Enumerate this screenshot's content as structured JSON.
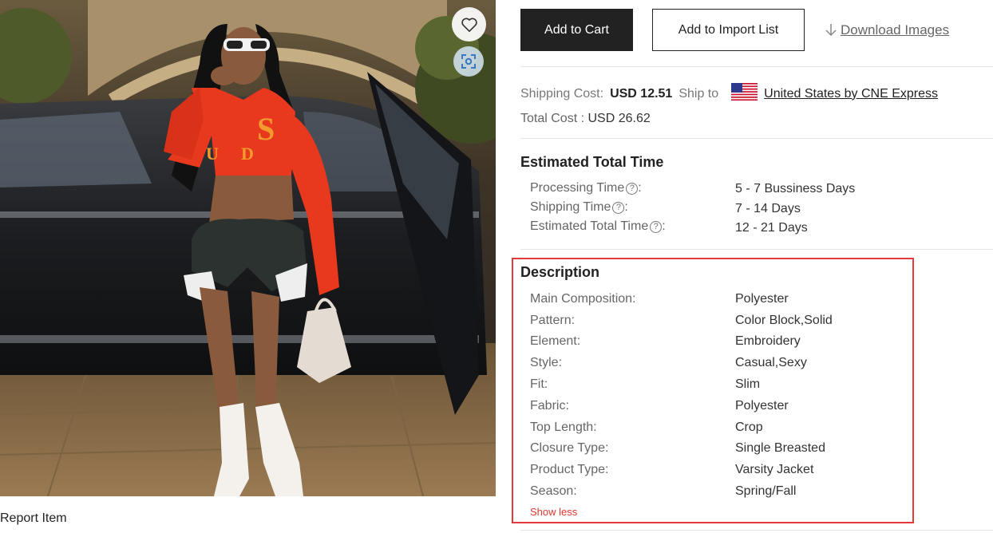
{
  "actions": {
    "add_to_cart": "Add to Cart",
    "add_to_import_list": "Add to Import List",
    "download_images": "Download Images"
  },
  "shipping": {
    "cost_label": "Shipping Cost:",
    "cost_value": "USD 12.51",
    "ship_to_label": "Ship to",
    "destination_method": "United States  by  CNE Express",
    "total_label": "Total Cost :",
    "total_value": "USD 26.62"
  },
  "estimated_time": {
    "title": "Estimated Total Time",
    "rows": [
      {
        "label": "Processing Time",
        "value": "5 - 7 Bussiness Days"
      },
      {
        "label": "Shipping Time",
        "value": "7 - 14 Days"
      },
      {
        "label": "Estimated Total Time",
        "value": "12 - 21 Days"
      }
    ],
    "help_glyph": "?",
    "colon": ":"
  },
  "description": {
    "title": "Description",
    "rows": [
      {
        "label": "Main Composition:",
        "value": "Polyester"
      },
      {
        "label": "Pattern:",
        "value": "Color Block,Solid"
      },
      {
        "label": "Element:",
        "value": "Embroidery"
      },
      {
        "label": "Style:",
        "value": "Casual,Sexy"
      },
      {
        "label": "Fit:",
        "value": "Slim"
      },
      {
        "label": "Fabric:",
        "value": "Polyester"
      },
      {
        "label": "Top Length:",
        "value": "Crop"
      },
      {
        "label": "Closure Type:",
        "value": "Single Breasted"
      },
      {
        "label": "Product Type:",
        "value": "Varsity Jacket"
      },
      {
        "label": "Season:",
        "value": "Spring/Fall"
      }
    ],
    "show_less": "Show less"
  },
  "report_item": "Report Item",
  "icons": {
    "favorite": "heart-icon",
    "image_search": "scan-icon",
    "download": "download-arrow-icon",
    "flag": "us-flag-icon"
  },
  "colors": {
    "primary_button": "#222222",
    "highlight_border": "#e23a3a",
    "show_less": "#e0362f",
    "jacket": "#e8391f"
  }
}
